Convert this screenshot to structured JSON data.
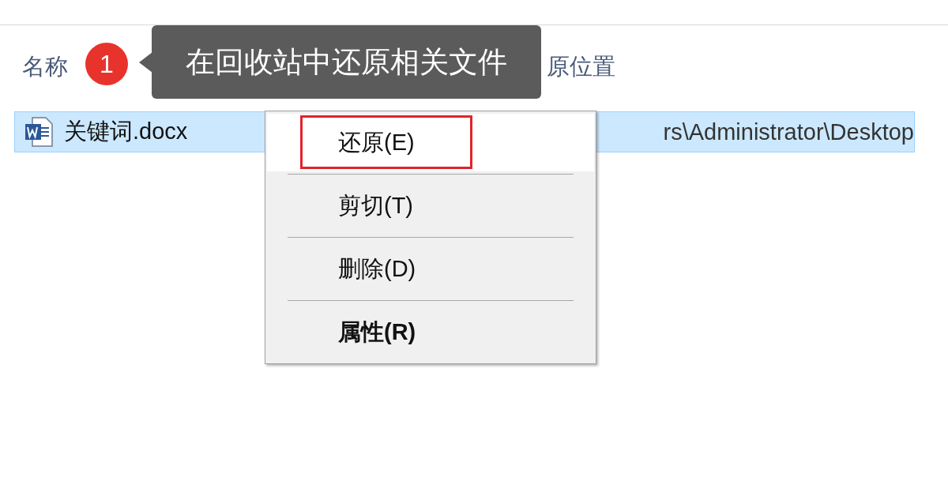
{
  "columns": [
    {
      "label": "名称"
    },
    {
      "label": "原位置"
    }
  ],
  "rows": [
    {
      "name": "关键词.docx",
      "location": "rs\\Administrator\\Desktop",
      "selected": true
    }
  ],
  "callout": {
    "badge": "1",
    "text": "在回收站中还原相关文件"
  },
  "context_menu": [
    {
      "label": "还原(E)",
      "selected": true,
      "highlighted": true,
      "default": false
    },
    {
      "label": "剪切(T)",
      "selected": false,
      "highlighted": false,
      "default": false
    },
    {
      "label": "删除(D)",
      "selected": false,
      "highlighted": false,
      "default": false
    },
    {
      "label": "属性(R)",
      "selected": false,
      "highlighted": false,
      "default": true
    }
  ]
}
